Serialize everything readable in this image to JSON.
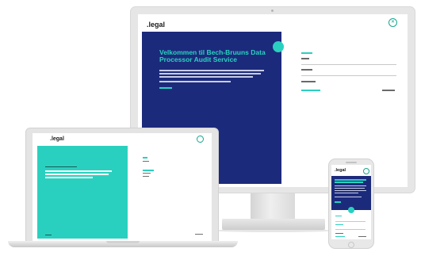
{
  "monitor": {
    "logo": ".legal",
    "close_icon": "close-icon",
    "heading": "Velkommen til Bech-Bruuns Data Processor Audit Service",
    "badge_icon": "badge-icon"
  },
  "laptop": {
    "logo": ".legal",
    "close_icon": "close-icon"
  },
  "phone": {
    "logo": ".legal",
    "close_icon": "close-icon",
    "home_icon": "home-button-icon"
  },
  "colors": {
    "navy": "#1c2a7c",
    "teal": "#2ad0bf",
    "device_gray": "#e6e6e6"
  }
}
